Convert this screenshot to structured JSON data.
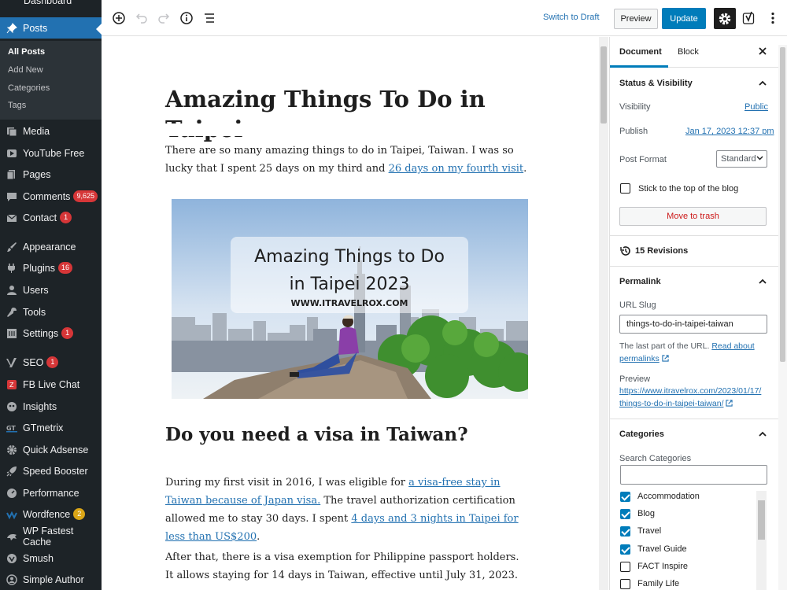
{
  "sidebar": {
    "dashboard_label": "Dashboard",
    "menu": [
      {
        "key": "posts",
        "label": "Posts",
        "icon": "pin-icon"
      },
      {
        "key": "media",
        "label": "Media",
        "icon": "media-icon"
      },
      {
        "key": "youtube",
        "label": "YouTube Free",
        "icon": "play-icon"
      },
      {
        "key": "pages",
        "label": "Pages",
        "icon": "page-icon"
      },
      {
        "key": "comments",
        "label": "Comments",
        "badge": "9,625",
        "icon": "comment-icon"
      },
      {
        "key": "contact",
        "label": "Contact",
        "badge": "1",
        "icon": "mail-icon"
      },
      {
        "key": "appearance",
        "label": "Appearance",
        "icon": "brush-icon"
      },
      {
        "key": "plugins",
        "label": "Plugins",
        "badge": "16",
        "icon": "plug-icon"
      },
      {
        "key": "users",
        "label": "Users",
        "icon": "user-icon"
      },
      {
        "key": "tools",
        "label": "Tools",
        "icon": "wrench-icon"
      },
      {
        "key": "settings",
        "label": "Settings",
        "badge": "1",
        "icon": "settings-icon"
      },
      {
        "key": "seo",
        "label": "SEO",
        "badge": "1",
        "icon": "yoast-icon"
      },
      {
        "key": "fb_live_chat",
        "label": "FB Live Chat",
        "icon": "chat-icon"
      },
      {
        "key": "insights",
        "label": "Insights",
        "icon": "insights-icon"
      },
      {
        "key": "gtmetrix",
        "label": "GTmetrix",
        "icon": "gtmetrix-icon"
      },
      {
        "key": "quick_adsense",
        "label": "Quick Adsense",
        "icon": "gear-icon"
      },
      {
        "key": "speed_booster",
        "label": "Speed Booster",
        "icon": "rocket-icon"
      },
      {
        "key": "performance",
        "label": "Performance",
        "icon": "gauge-icon"
      },
      {
        "key": "wordfence",
        "label": "Wordfence",
        "badge": "2",
        "icon": "wordfence-icon"
      },
      {
        "key": "wp_fastest_cache",
        "label": "WP Fastest Cache",
        "icon": "cheetah-icon"
      },
      {
        "key": "smush",
        "label": "Smush",
        "icon": "smush-icon"
      },
      {
        "key": "simple_author",
        "label": "Simple Author",
        "icon": "author-icon"
      }
    ],
    "posts_submenu": [
      "All Posts",
      "Add New",
      "Categories",
      "Tags"
    ]
  },
  "toolbar": {
    "switch_to_draft": "Switch to Draft",
    "preview": "Preview",
    "update": "Update"
  },
  "editor": {
    "title": "Amazing Things To Do in Taipei",
    "intro_text": "There are so many amazing things to do in Taipei, Taiwan. I was so lucky that I spent 25 days on my third and ",
    "intro_link": "26 days on my fourth visit",
    "intro_end": ".",
    "image": {
      "line1": "Amazing Things to Do",
      "line2": "in Taipei 2023",
      "site": "WWW.ITRAVELROX.COM"
    },
    "heading": "Do you need a visa in Taiwan?",
    "visa_p1_a": "During my first visit in 2016, I was eligible for ",
    "visa_p1_link1": "a visa-free stay in Taiwan because of Japan visa.",
    "visa_p1_b": " The travel authorization certification allowed me to stay 30 days. I spent ",
    "visa_p1_link2": "4 days and 3 nights in Taipei for less than US$200",
    "visa_p1_c": ".",
    "visa_p2": "After that, there is a visa exemption for Philippine passport holders. It allows staying for 14 days in Taiwan, effective until July 31, 2023."
  },
  "settings": {
    "tab_document": "Document",
    "tab_block": "Block",
    "status_title": "Status & Visibility",
    "visibility_label": "Visibility",
    "visibility_value": "Public",
    "publish_label": "Publish",
    "publish_value": "Jan 17, 2023 12:37 pm",
    "post_format_label": "Post Format",
    "post_format_value": "Standard",
    "sticky_label": "Stick to the top of the blog",
    "trash_label": "Move to trash",
    "revisions_label": "15 Revisions",
    "permalink_title": "Permalink",
    "url_slug_label": "URL Slug",
    "url_slug_value": "things-to-do-in-taipei-taiwan",
    "slug_help": "The last part of the URL. ",
    "slug_help_link": "Read about permalinks",
    "preview_label": "Preview",
    "preview_url_1": "https://www.itravelrox.com/2023/01/17/",
    "preview_url_2": "things-to-do-in-taipei-taiwan/",
    "categories_title": "Categories",
    "search_categories_label": "Search Categories",
    "categories": [
      {
        "label": "Accommodation",
        "checked": true
      },
      {
        "label": "Blog",
        "checked": true
      },
      {
        "label": "Travel",
        "checked": true
      },
      {
        "label": "Travel Guide",
        "checked": true
      },
      {
        "label": "FACT Inspire",
        "checked": false
      },
      {
        "label": "Family Life",
        "checked": false
      }
    ]
  },
  "colors": {
    "admin_bar": "#1d2327",
    "accent": "#007cba",
    "link": "#2271b1",
    "badge": "#d63638"
  }
}
